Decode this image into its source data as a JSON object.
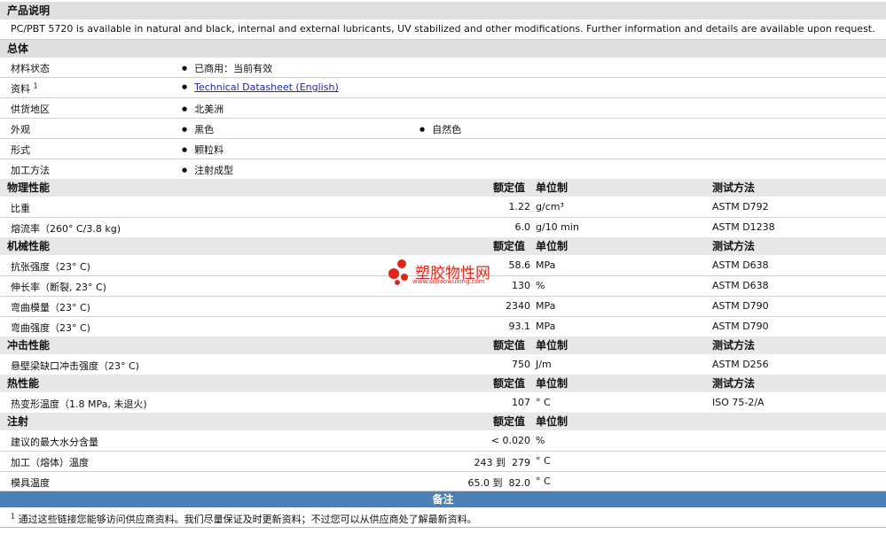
{
  "desc": {
    "title": "产品说明",
    "text": "PC/PBT 5720 is available in natural and black, internal and external lubricants, UV stabilized and other modifications. Further information and details are available upon request."
  },
  "general": {
    "title": "总体",
    "status_label": "材料状态",
    "status_value": "已商用：当前有效",
    "docs_label": "资料",
    "docs_sup": "1",
    "docs_link": "Technical Datasheet (English)",
    "region_label": "供货地区",
    "region_value": "北美洲",
    "appearance_label": "外观",
    "appearance_value1": "黑色",
    "appearance_value2": "自然色",
    "form_label": "形式",
    "form_value": "颗粒料",
    "process_label": "加工方法",
    "process_value": "注射成型"
  },
  "headers": {
    "nominal": "额定值",
    "unit": "单位制",
    "method": "测试方法"
  },
  "physical": {
    "title": "物理性能",
    "rows": [
      {
        "name": "比重",
        "value": "1.22",
        "unit": "g/cm³",
        "method": "ASTM D792"
      },
      {
        "name": "熔流率（260° C/3.8 kg)",
        "value": "6.0",
        "unit": "g/10 min",
        "method": "ASTM D1238"
      }
    ]
  },
  "mechanical": {
    "title": "机械性能",
    "rows": [
      {
        "name": "抗张强度（23° C)",
        "value": "58.6",
        "unit": "MPa",
        "method": "ASTM D638"
      },
      {
        "name": "伸长率（断裂, 23° C)",
        "value": "130",
        "unit": "%",
        "method": "ASTM D638"
      },
      {
        "name": "弯曲模量（23° C)",
        "value": "2340",
        "unit": "MPa",
        "method": "ASTM D790"
      },
      {
        "name": "弯曲强度（23° C)",
        "value": "93.1",
        "unit": "MPa",
        "method": "ASTM D790"
      }
    ]
  },
  "impact": {
    "title": "冲击性能",
    "rows": [
      {
        "name": "悬壁梁缺口冲击强度（23° C)",
        "value": "750",
        "unit": "J/m",
        "method": "ASTM D256"
      }
    ]
  },
  "thermal": {
    "title": "热性能",
    "rows": [
      {
        "name": "热变形温度（1.8 MPa, 未退火)",
        "value": "107",
        "unit": "° C",
        "method": "ISO 75-2/A"
      }
    ]
  },
  "injection": {
    "title": "注射",
    "rows": [
      {
        "name": "建议的最大水分含量",
        "value": "< 0.020",
        "unit": "%"
      },
      {
        "name": "加工（熔体）温度",
        "value": "243 到  279",
        "unit": "° C"
      },
      {
        "name": "模具温度",
        "value": "65.0 到  82.0",
        "unit": "° C"
      }
    ]
  },
  "notes": {
    "title": "备注",
    "sup": "1",
    "text": "通过这些链接您能够访问供应商资料。我们尽量保证及时更新资料；不过您可以从供应商处了解最新资料。"
  },
  "watermark": {
    "text": "塑胶物性网",
    "url": "www.sujiaowuxing.com",
    "color": "#e0261a"
  }
}
